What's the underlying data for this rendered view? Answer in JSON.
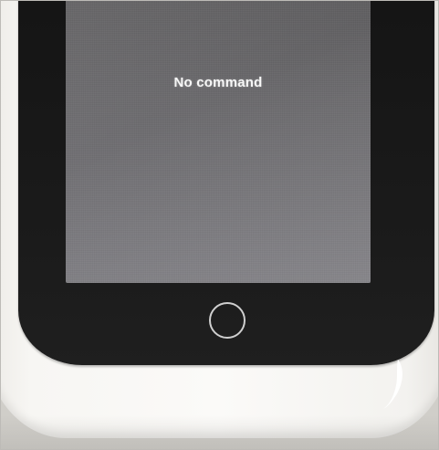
{
  "screen": {
    "message": "No command"
  },
  "colors": {
    "screen_background": "#6a696c",
    "phone_body": "#f7f6f3",
    "phone_front": "#1b1b1b",
    "home_ring": "#cfcfcf"
  },
  "icons": {
    "home_button": "home-button-icon"
  }
}
